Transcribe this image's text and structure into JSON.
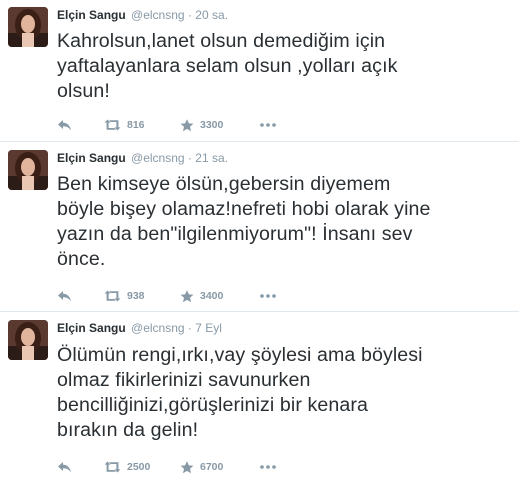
{
  "tweets": [
    {
      "name": "Elçin Sangu",
      "handle": "@elcnsng",
      "dot": "·",
      "time": "20 sa.",
      "lines": [
        "Kahrolsun,lanet olsun demediğim için",
        "yaftalayanlara selam olsun ,yolları açık",
        "olsun!"
      ],
      "retweets": "816",
      "favorites": "3300"
    },
    {
      "name": "Elçin Sangu",
      "handle": "@elcnsng",
      "dot": "·",
      "time": "21 sa.",
      "lines": [
        "Ben kimseye ölsün,gebersin diyemem",
        "böyle bişey olamaz!nefreti hobi olarak yine",
        "yazın da ben\"ilgilenmiyorum\"! İnsanı sev",
        "önce."
      ],
      "retweets": "938",
      "favorites": "3400"
    },
    {
      "name": "Elçin Sangu",
      "handle": "@elcnsng",
      "dot": "·",
      "time": "7 Eyl",
      "lines": [
        "Ölümün rengi,ırkı,vay şöylesi ama böylesi",
        "olmaz fikirlerinizi savunurken",
        "bencilliğinizi,görüşlerinizi bir kenara",
        "bırakın da gelin!"
      ],
      "retweets": "2500",
      "favorites": "6700"
    }
  ],
  "icons": [
    "reply-icon",
    "retweet-icon",
    "favorite-star-icon",
    "more-options-icon"
  ],
  "colors": {
    "text": "#292f33",
    "muted": "#8899a6",
    "divider": "#e1e8ed"
  }
}
